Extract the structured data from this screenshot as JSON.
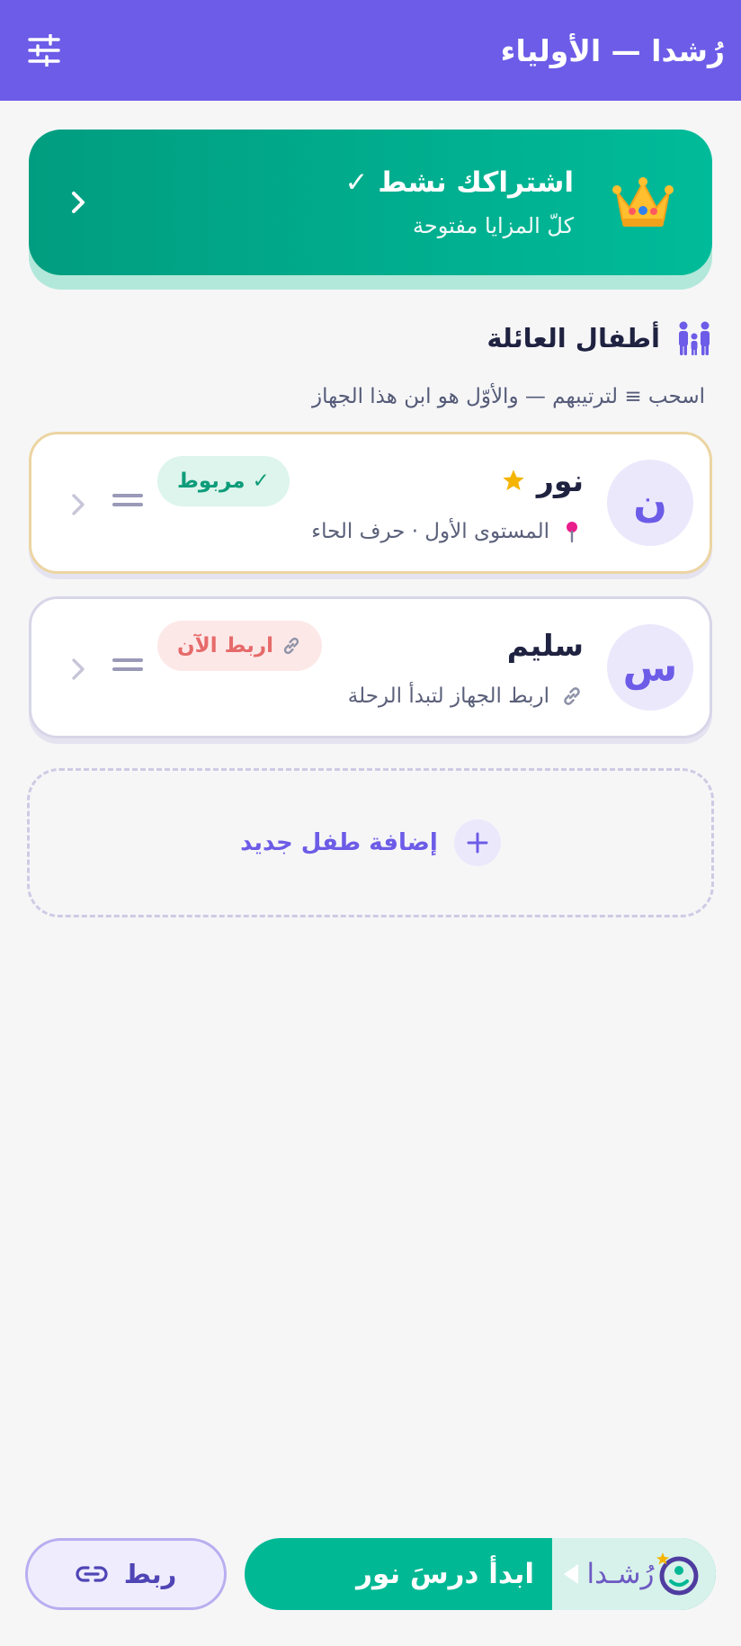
{
  "header": {
    "title": "رُشدا — الأولياء",
    "filter_icon": "sliders-icon"
  },
  "subscription": {
    "title": "اشتراكك نشط ✓",
    "subtitle": "كلّ المزايا مفتوحة",
    "icon": "crown-icon"
  },
  "family": {
    "title": "أطفال العائلة",
    "hint": "اسحب ≡ لترتيبهم — والأوّل هو ابن هذا الجهاز",
    "icon": "family-icon",
    "children": [
      {
        "initial": "ن",
        "name": "نور",
        "detail": "المستوى الأول · حرف الحاء",
        "badge": "✓ مربوط",
        "status": "linked"
      },
      {
        "initial": "س",
        "name": "سليم",
        "detail": "اربط الجهاز لتبدأ الرحلة",
        "badge": "اربط الآن",
        "status": "unlinked"
      }
    ],
    "add_label": "إضافة طفل جديد"
  },
  "bottom": {
    "link_label": "ربط",
    "start_label": "ابدأ درسَ نور",
    "brand_name": "رُشـدا"
  },
  "colors": {
    "primary": "#6c5ce7",
    "accent_green": "#00b894",
    "linked_green": "#0f9c7a",
    "unlinked_red": "#e66a6a",
    "gold": "#f4b400"
  }
}
